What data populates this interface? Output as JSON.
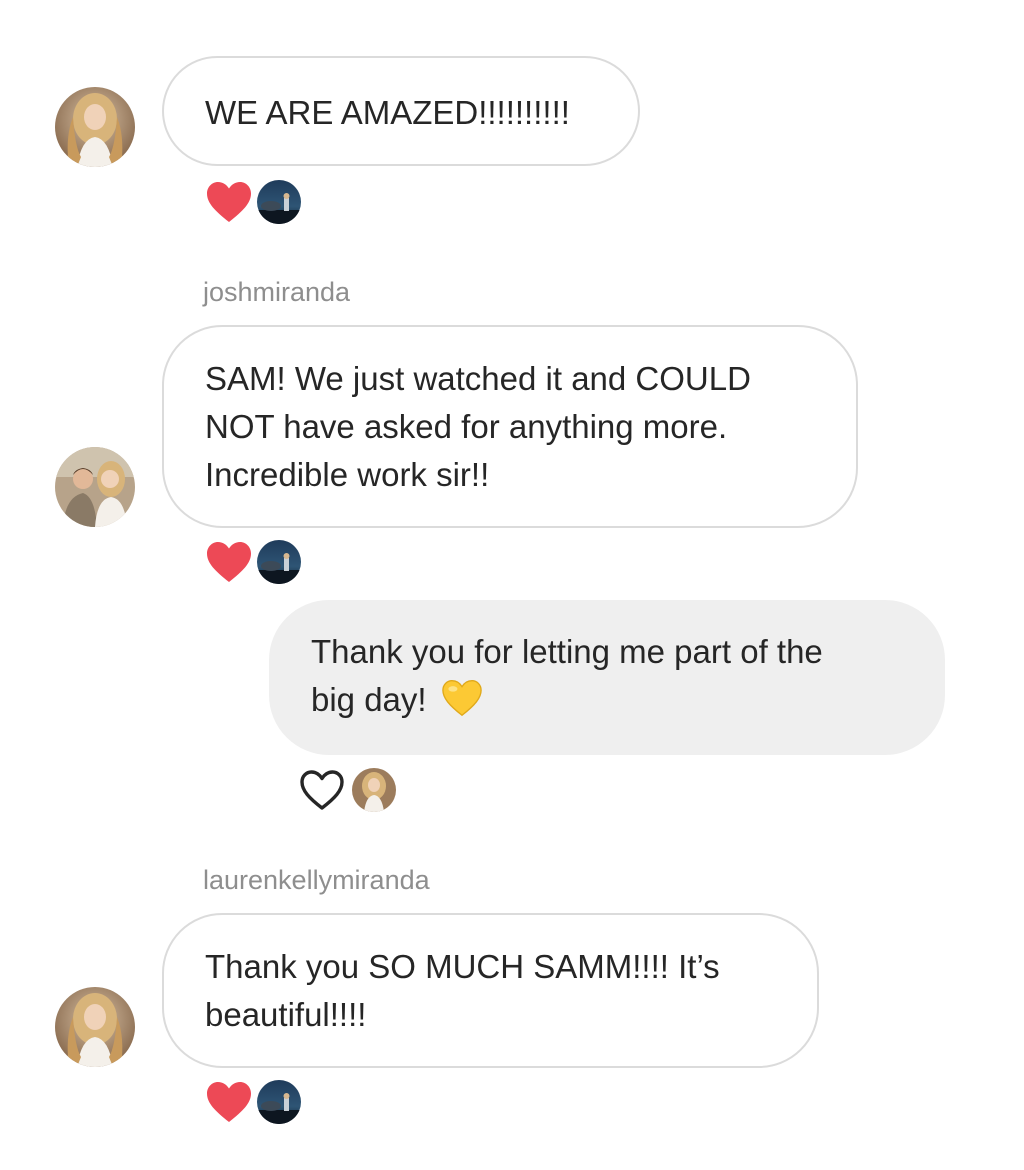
{
  "colors": {
    "heart_red": "#ed4956",
    "heart_outline": "#262626",
    "heart_yellow": "#fcc934",
    "bubble_border": "#dbdbdb",
    "outgoing_bg": "#efefef",
    "username_gray": "#8e8e8e"
  },
  "messages": [
    {
      "direction": "incoming",
      "username": "",
      "lines": [
        "WE ARE AMAZED!!!!!!!!!!"
      ],
      "reaction": "heart-filled"
    },
    {
      "direction": "incoming",
      "username": "joshmiranda",
      "lines": [
        "SAM! We just watched it and COULD",
        "NOT have asked for anything more.",
        "Incredible work sir!!"
      ],
      "reaction": "heart-filled"
    },
    {
      "direction": "outgoing",
      "username": "",
      "lines": [
        "Thank you for letting me part of the",
        "big day! "
      ],
      "emoji": "yellow-heart-icon",
      "reaction": "heart-outline"
    },
    {
      "direction": "incoming",
      "username": "laurenkellymiranda",
      "lines": [
        "Thank you SO MUCH SAMM!!!! It’s",
        "beautiful!!!!"
      ],
      "reaction": "heart-filled"
    }
  ]
}
